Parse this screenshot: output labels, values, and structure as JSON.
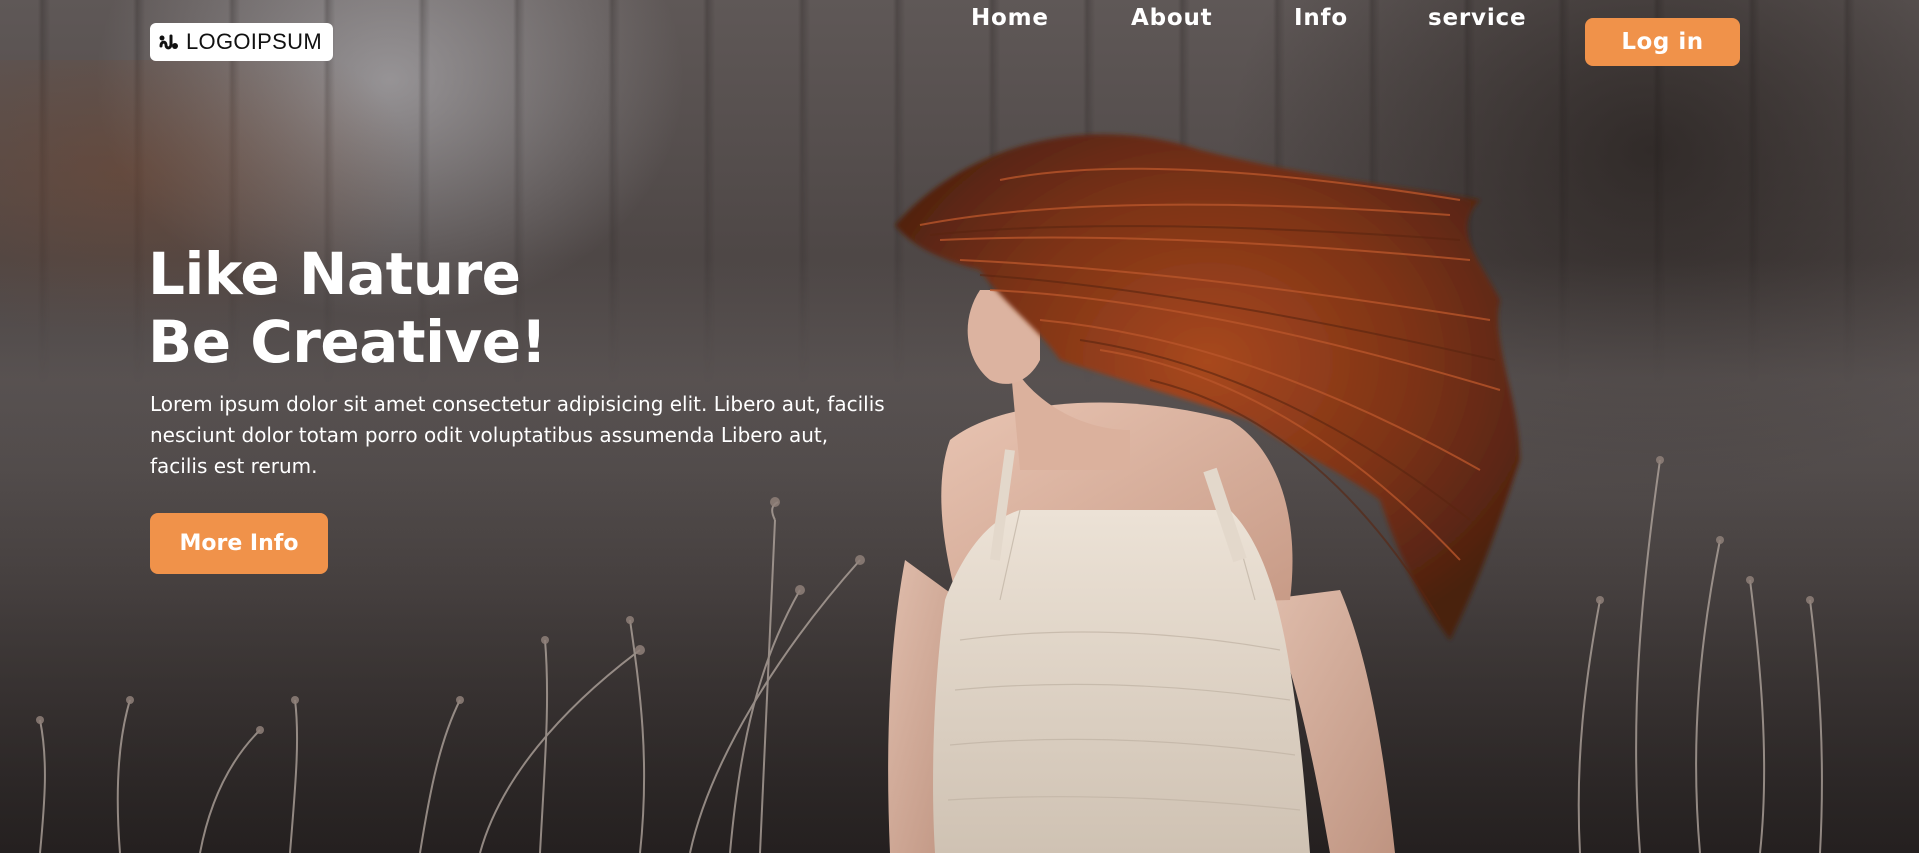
{
  "brand": {
    "logo_text": "LOGOIPSUM",
    "logo_icon": "logo-mark-icon"
  },
  "nav": {
    "items": [
      {
        "label": "Home"
      },
      {
        "label": "About"
      },
      {
        "label": "Info"
      },
      {
        "label": "service"
      }
    ],
    "login_label": "Log in"
  },
  "hero": {
    "title_line1": "Like Nature",
    "title_line2": "Be Creative!",
    "description": "Lorem ipsum dolor sit amet consectetur adipisicing elit. Libero aut, facilis nesciunt dolor totam porro odit voluptatibus assumenda Libero aut, facilis est rerum.",
    "cta_label": "More Info",
    "background_image": "woman with flowing red hair in white dress standing in a dry grass field"
  },
  "colors": {
    "accent": "#f0924a",
    "text": "#ffffff",
    "logo_bg": "#ffffff"
  }
}
